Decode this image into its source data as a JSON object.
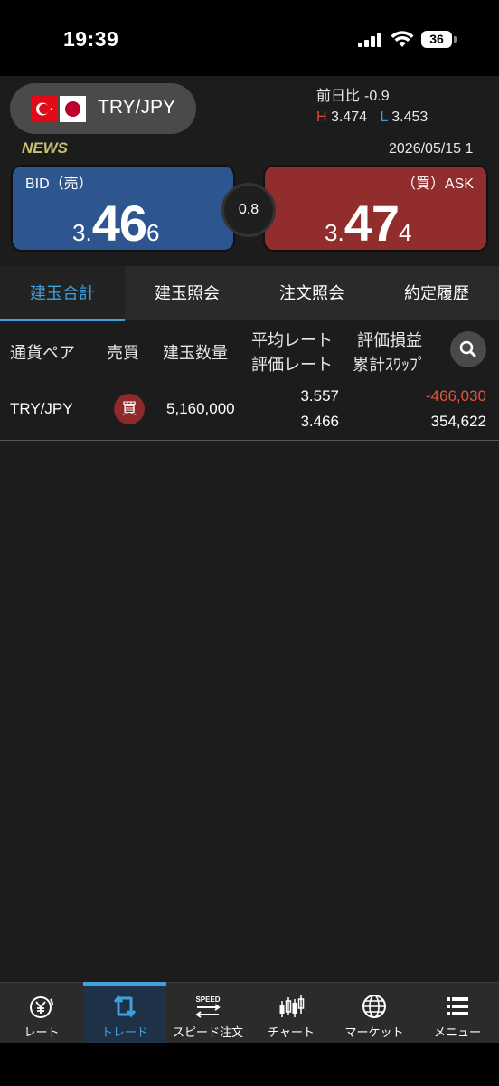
{
  "status_bar": {
    "time": "19:39",
    "battery": "36"
  },
  "header": {
    "pair": "TRY/JPY",
    "change_label": "前日比",
    "change_value": "-0.9",
    "high_label": "H",
    "high_value": "3.474",
    "low_label": "L",
    "low_value": "3.453",
    "news_label": "NEWS",
    "date": "2026/05/15 1"
  },
  "quote": {
    "bid_label": "BID（売）",
    "bid_prefix": "3.",
    "bid_main": "46",
    "bid_tail": "6",
    "ask_label": "（買）ASK",
    "ask_prefix": "3.",
    "ask_main": "47",
    "ask_tail": "4",
    "spread": "0.8"
  },
  "tabs": [
    {
      "label": "建玉合計",
      "active": true
    },
    {
      "label": "建玉照会",
      "active": false
    },
    {
      "label": "注文照会",
      "active": false
    },
    {
      "label": "約定履歴",
      "active": false
    }
  ],
  "table": {
    "headers": {
      "pair": "通貨ペア",
      "side": "売買",
      "quantity": "建玉数量",
      "avg_rate": "平均レート",
      "eval_rate": "評価レート",
      "eval_pl": "評価損益",
      "swap": "累計ｽﾜｯﾌﾟ"
    },
    "rows": [
      {
        "pair": "TRY/JPY",
        "side": "買",
        "quantity": "5,160,000",
        "avg_rate": "3.557",
        "eval_rate": "3.466",
        "eval_pl": "-466,030",
        "swap": "354,622"
      }
    ]
  },
  "bottom_nav": [
    {
      "label": "レート",
      "icon": "yen-rate-icon",
      "active": false
    },
    {
      "label": "トレード",
      "icon": "trade-arrows-icon",
      "active": true
    },
    {
      "label": "スピード注文",
      "icon": "speed-order-icon",
      "active": false
    },
    {
      "label": "チャート",
      "icon": "candlestick-chart-icon",
      "active": false
    },
    {
      "label": "マーケット",
      "icon": "globe-icon",
      "active": false
    },
    {
      "label": "メニュー",
      "icon": "menu-list-icon",
      "active": false
    }
  ],
  "colors": {
    "accent": "#3fa2de",
    "bid": "#2d5590",
    "ask": "#922d2d",
    "negative": "#e2543f"
  }
}
